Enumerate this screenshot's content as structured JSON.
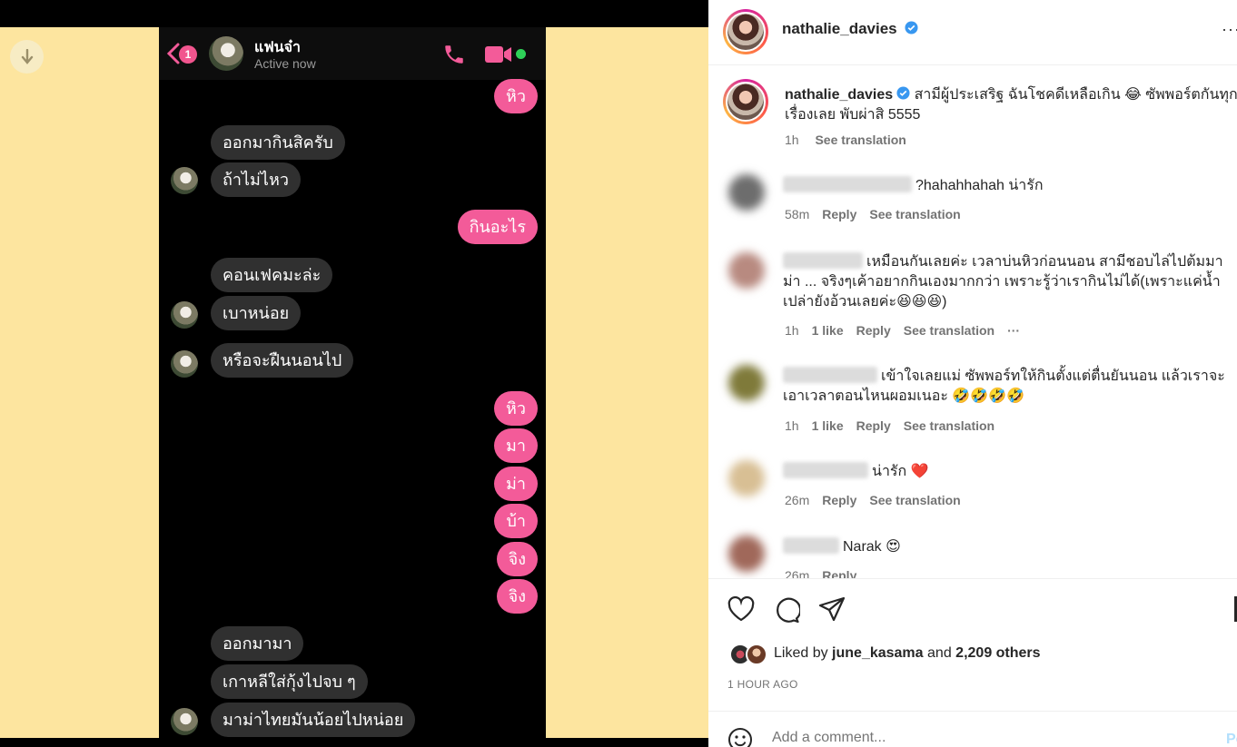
{
  "chat": {
    "contact_name": "แฟนจ๋า",
    "status": "Active now",
    "unread_count": "1",
    "messages": [
      {
        "side": "out",
        "text": "หิว"
      },
      {
        "side": "in",
        "text": "ออกมากินสิครับ"
      },
      {
        "side": "in",
        "text": "ถ้าไม่ไหว"
      },
      {
        "side": "out",
        "text": "กินอะไร"
      },
      {
        "side": "in",
        "text": "คอนเฟคมะล่ะ"
      },
      {
        "side": "in",
        "text": "เบาหน่อย"
      },
      {
        "side": "in",
        "text": "หรือจะฝืนนอนไป"
      },
      {
        "side": "out",
        "text": "หิว"
      },
      {
        "side": "out",
        "text": "มา"
      },
      {
        "side": "out",
        "text": "ม่า"
      },
      {
        "side": "out",
        "text": "บ้า"
      },
      {
        "side": "out",
        "text": "จิง"
      },
      {
        "side": "out",
        "text": "จิง"
      },
      {
        "side": "in",
        "text": "ออกมามา"
      },
      {
        "side": "in",
        "text": "เกาหลีใส่กุ้งไปจบ ๆ"
      },
      {
        "side": "in",
        "text": "มาม่าไทยมันน้อยไปหน่อย"
      }
    ]
  },
  "post": {
    "username": "nathalie_davies",
    "caption_user": "nathalie_davies",
    "caption": "สามีผู้ประเสริฐ ฉันโชคดีเหลือเกิน 😂 ซัพพอร์ตกันทุกเรื่องเลย พับผ่าสิ 5555",
    "caption_time": "1h",
    "see_translation": "See translation",
    "more_dots": "···",
    "comments": [
      {
        "text": "?hahahhahah น่ารัก",
        "time": "58m",
        "likes": "",
        "reply": "Reply",
        "translate": "See translation",
        "more": ""
      },
      {
        "text": "เหมือนกันเลยค่ะ เวลาบ่นหิวก่อนนอน สามีชอบไล่ไปต้มมาม่า ... จริงๆเค้าอยากกินเองมากกว่า เพราะรู้ว่าเรากินไม่ได้(เพราะแค่น้ำเปล่ายังอ้วนเลยค่ะ😆😆😆)",
        "time": "1h",
        "likes": "1 like",
        "reply": "Reply",
        "translate": "See translation",
        "more": "···"
      },
      {
        "text": "เข้าใจเลยแม่ ซัพพอร์ทให้กินตั้งแต่ตื่นยันนอน แล้วเราจะเอาเวลาตอนไหนผอมเนอะ 🤣🤣🤣🤣",
        "time": "1h",
        "likes": "1 like",
        "reply": "Reply",
        "translate": "See translation",
        "more": ""
      },
      {
        "text": "น่ารัก ❤️",
        "time": "26m",
        "likes": "",
        "reply": "Reply",
        "translate": "See translation",
        "more": ""
      },
      {
        "text": "Narak 😍",
        "time": "26m",
        "likes": "",
        "reply": "Reply",
        "translate": "",
        "more": ""
      }
    ],
    "liked_by_prefix": "Liked by",
    "liked_by_user": "june_kasama",
    "liked_by_and": "and",
    "liked_by_others": "2,209 others",
    "time_ago": "1 HOUR AGO",
    "add_comment_placeholder": "Add a comment...",
    "post_label": "Post"
  },
  "icons": {
    "download": "download-icon",
    "back": "back-arrow-icon",
    "phone": "phone-icon",
    "video": "video-camera-icon",
    "like": "heart-icon",
    "comment": "comment-icon",
    "share": "share-icon",
    "emoji": "emoji-icon",
    "verified": "verified-badge-icon"
  },
  "colors": {
    "outgoing_bubble": "#f35b99",
    "incoming_bubble": "#303030",
    "background_yellow": "#fde59f",
    "verified_blue": "#3897f0",
    "online_green": "#2ed158"
  }
}
